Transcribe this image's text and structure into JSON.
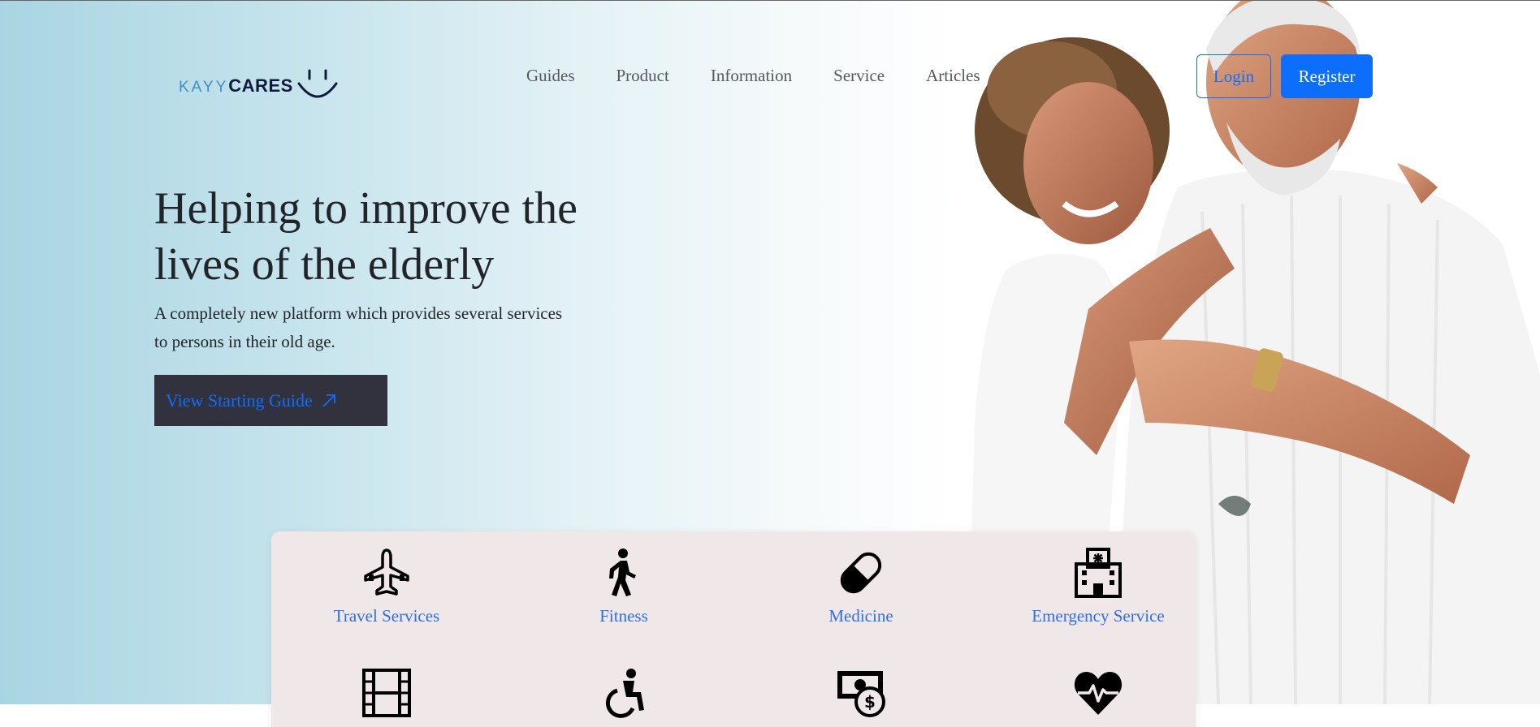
{
  "brand": {
    "name_light": "KAYY",
    "name_bold": "CARES"
  },
  "nav": {
    "items": [
      "Guides",
      "Product",
      "Information",
      "Service",
      "Articles"
    ]
  },
  "auth": {
    "login_label": "Login",
    "register_label": "Register"
  },
  "hero": {
    "headline": "Helping to improve the lives of the elderly",
    "subtext": "A completely new platform which provides several services to persons in their old age.",
    "cta_label": "View Starting Guide"
  },
  "services": [
    {
      "label": "Travel Services",
      "icon": "airplane-icon"
    },
    {
      "label": "Fitness",
      "icon": "walking-person-icon"
    },
    {
      "label": "Medicine",
      "icon": "capsule-icon"
    },
    {
      "label": "Emergency Service",
      "icon": "hospital-icon"
    },
    {
      "label": "",
      "icon": "film-icon"
    },
    {
      "label": "",
      "icon": "wheelchair-icon"
    },
    {
      "label": "",
      "icon": "money-icon"
    },
    {
      "label": "",
      "icon": "heart-pulse-icon"
    }
  ],
  "colors": {
    "accent": "#0d6efd",
    "cta_bg": "#32323e",
    "services_bg": "#f0e7e8",
    "hero_gradient_start": "#a9d5e2"
  }
}
